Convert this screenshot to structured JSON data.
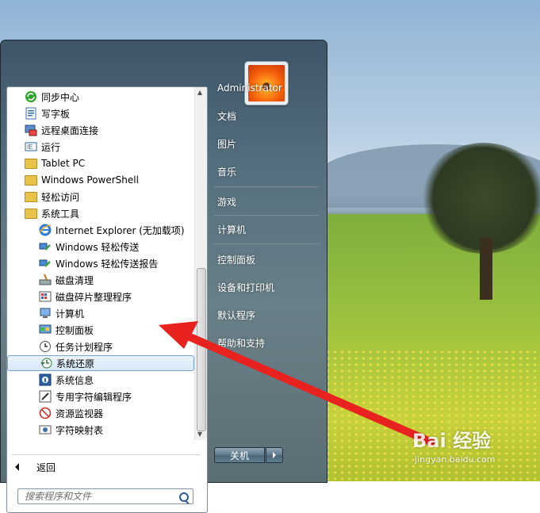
{
  "user": {
    "name": "Administrator"
  },
  "programs": [
    {
      "label": "同步中心",
      "icon": "sync-center-icon"
    },
    {
      "label": "写字板",
      "icon": "wordpad-icon"
    },
    {
      "label": "远程桌面连接",
      "icon": "remote-desktop-icon"
    },
    {
      "label": "运行",
      "icon": "run-icon"
    },
    {
      "label": "Tablet PC",
      "icon": "folder-icon"
    },
    {
      "label": "Windows PowerShell",
      "icon": "folder-icon"
    },
    {
      "label": "轻松访问",
      "icon": "folder-icon"
    },
    {
      "label": "系统工具",
      "icon": "folder-icon"
    },
    {
      "label": "Internet Explorer (无加载项)",
      "icon": "internet-explorer-icon"
    },
    {
      "label": "Windows 轻松传送",
      "icon": "easy-transfer-icon"
    },
    {
      "label": "Windows 轻松传送报告",
      "icon": "easy-transfer-report-icon"
    },
    {
      "label": "磁盘清理",
      "icon": "disk-cleanup-icon"
    },
    {
      "label": "磁盘碎片整理程序",
      "icon": "disk-defrag-icon"
    },
    {
      "label": "计算机",
      "icon": "computer-icon"
    },
    {
      "label": "控制面板",
      "icon": "control-panel-icon"
    },
    {
      "label": "任务计划程序",
      "icon": "task-scheduler-icon"
    },
    {
      "label": "系统还原",
      "icon": "system-restore-icon"
    },
    {
      "label": "系统信息",
      "icon": "system-info-icon"
    },
    {
      "label": "专用字符编辑程序",
      "icon": "char-editor-icon"
    },
    {
      "label": "资源监视器",
      "icon": "resource-monitor-icon"
    },
    {
      "label": "字符映射表",
      "icon": "char-map-icon"
    }
  ],
  "back_label": "返回",
  "search": {
    "placeholder": "搜索程序和文件"
  },
  "right_items": [
    "文档",
    "图片",
    "音乐",
    "游戏",
    "计算机",
    "控制面板",
    "设备和打印机",
    "默认程序",
    "帮助和支持"
  ],
  "shutdown_label": "关机",
  "watermark": {
    "main": "Bai 经验",
    "sub": "jingyan.baidu.com"
  },
  "colors": {
    "accent_red": "#e8231f",
    "selection": "#d6e8f9"
  }
}
